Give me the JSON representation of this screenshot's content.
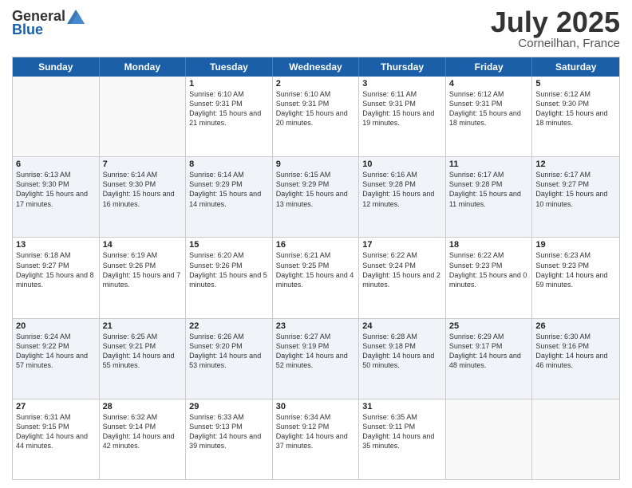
{
  "header": {
    "logo_general": "General",
    "logo_blue": "Blue",
    "month": "July 2025",
    "location": "Corneilhan, France"
  },
  "days_of_week": [
    "Sunday",
    "Monday",
    "Tuesday",
    "Wednesday",
    "Thursday",
    "Friday",
    "Saturday"
  ],
  "weeks": [
    [
      {
        "day": "",
        "text": ""
      },
      {
        "day": "",
        "text": ""
      },
      {
        "day": "1",
        "text": "Sunrise: 6:10 AM\nSunset: 9:31 PM\nDaylight: 15 hours and 21 minutes."
      },
      {
        "day": "2",
        "text": "Sunrise: 6:10 AM\nSunset: 9:31 PM\nDaylight: 15 hours and 20 minutes."
      },
      {
        "day": "3",
        "text": "Sunrise: 6:11 AM\nSunset: 9:31 PM\nDaylight: 15 hours and 19 minutes."
      },
      {
        "day": "4",
        "text": "Sunrise: 6:12 AM\nSunset: 9:31 PM\nDaylight: 15 hours and 18 minutes."
      },
      {
        "day": "5",
        "text": "Sunrise: 6:12 AM\nSunset: 9:30 PM\nDaylight: 15 hours and 18 minutes."
      }
    ],
    [
      {
        "day": "6",
        "text": "Sunrise: 6:13 AM\nSunset: 9:30 PM\nDaylight: 15 hours and 17 minutes."
      },
      {
        "day": "7",
        "text": "Sunrise: 6:14 AM\nSunset: 9:30 PM\nDaylight: 15 hours and 16 minutes."
      },
      {
        "day": "8",
        "text": "Sunrise: 6:14 AM\nSunset: 9:29 PM\nDaylight: 15 hours and 14 minutes."
      },
      {
        "day": "9",
        "text": "Sunrise: 6:15 AM\nSunset: 9:29 PM\nDaylight: 15 hours and 13 minutes."
      },
      {
        "day": "10",
        "text": "Sunrise: 6:16 AM\nSunset: 9:28 PM\nDaylight: 15 hours and 12 minutes."
      },
      {
        "day": "11",
        "text": "Sunrise: 6:17 AM\nSunset: 9:28 PM\nDaylight: 15 hours and 11 minutes."
      },
      {
        "day": "12",
        "text": "Sunrise: 6:17 AM\nSunset: 9:27 PM\nDaylight: 15 hours and 10 minutes."
      }
    ],
    [
      {
        "day": "13",
        "text": "Sunrise: 6:18 AM\nSunset: 9:27 PM\nDaylight: 15 hours and 8 minutes."
      },
      {
        "day": "14",
        "text": "Sunrise: 6:19 AM\nSunset: 9:26 PM\nDaylight: 15 hours and 7 minutes."
      },
      {
        "day": "15",
        "text": "Sunrise: 6:20 AM\nSunset: 9:26 PM\nDaylight: 15 hours and 5 minutes."
      },
      {
        "day": "16",
        "text": "Sunrise: 6:21 AM\nSunset: 9:25 PM\nDaylight: 15 hours and 4 minutes."
      },
      {
        "day": "17",
        "text": "Sunrise: 6:22 AM\nSunset: 9:24 PM\nDaylight: 15 hours and 2 minutes."
      },
      {
        "day": "18",
        "text": "Sunrise: 6:22 AM\nSunset: 9:23 PM\nDaylight: 15 hours and 0 minutes."
      },
      {
        "day": "19",
        "text": "Sunrise: 6:23 AM\nSunset: 9:23 PM\nDaylight: 14 hours and 59 minutes."
      }
    ],
    [
      {
        "day": "20",
        "text": "Sunrise: 6:24 AM\nSunset: 9:22 PM\nDaylight: 14 hours and 57 minutes."
      },
      {
        "day": "21",
        "text": "Sunrise: 6:25 AM\nSunset: 9:21 PM\nDaylight: 14 hours and 55 minutes."
      },
      {
        "day": "22",
        "text": "Sunrise: 6:26 AM\nSunset: 9:20 PM\nDaylight: 14 hours and 53 minutes."
      },
      {
        "day": "23",
        "text": "Sunrise: 6:27 AM\nSunset: 9:19 PM\nDaylight: 14 hours and 52 minutes."
      },
      {
        "day": "24",
        "text": "Sunrise: 6:28 AM\nSunset: 9:18 PM\nDaylight: 14 hours and 50 minutes."
      },
      {
        "day": "25",
        "text": "Sunrise: 6:29 AM\nSunset: 9:17 PM\nDaylight: 14 hours and 48 minutes."
      },
      {
        "day": "26",
        "text": "Sunrise: 6:30 AM\nSunset: 9:16 PM\nDaylight: 14 hours and 46 minutes."
      }
    ],
    [
      {
        "day": "27",
        "text": "Sunrise: 6:31 AM\nSunset: 9:15 PM\nDaylight: 14 hours and 44 minutes."
      },
      {
        "day": "28",
        "text": "Sunrise: 6:32 AM\nSunset: 9:14 PM\nDaylight: 14 hours and 42 minutes."
      },
      {
        "day": "29",
        "text": "Sunrise: 6:33 AM\nSunset: 9:13 PM\nDaylight: 14 hours and 39 minutes."
      },
      {
        "day": "30",
        "text": "Sunrise: 6:34 AM\nSunset: 9:12 PM\nDaylight: 14 hours and 37 minutes."
      },
      {
        "day": "31",
        "text": "Sunrise: 6:35 AM\nSunset: 9:11 PM\nDaylight: 14 hours and 35 minutes."
      },
      {
        "day": "",
        "text": ""
      },
      {
        "day": "",
        "text": ""
      }
    ]
  ]
}
